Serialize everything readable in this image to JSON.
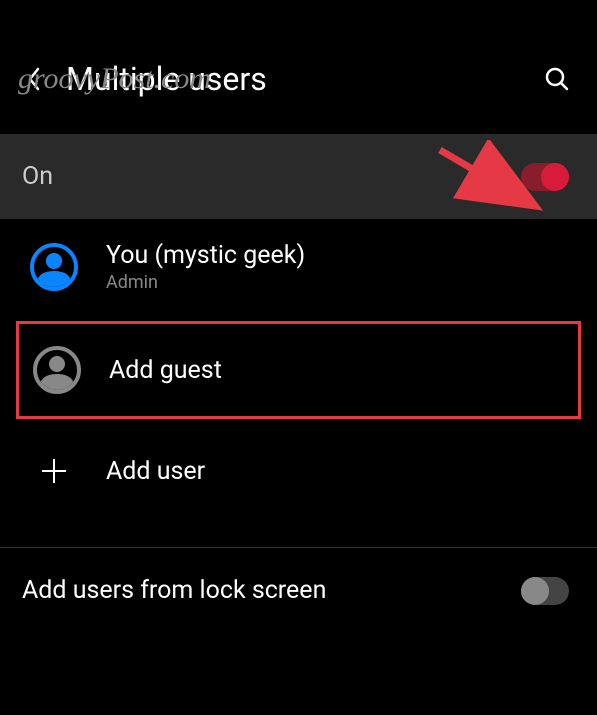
{
  "watermark": "groovyPost.com",
  "header": {
    "title": "Multiple users"
  },
  "mainToggle": {
    "label": "On",
    "enabled": true
  },
  "users": [
    {
      "name": "You (mystic geek)",
      "role": "Admin"
    }
  ],
  "actions": {
    "addGuest": "Add guest",
    "addUser": "Add user"
  },
  "lockScreen": {
    "label": "Add users from lock screen",
    "enabled": false
  },
  "colors": {
    "accent": "#d81b3a",
    "highlight": "#e63946",
    "userIconBlue": "#0a84ff"
  }
}
